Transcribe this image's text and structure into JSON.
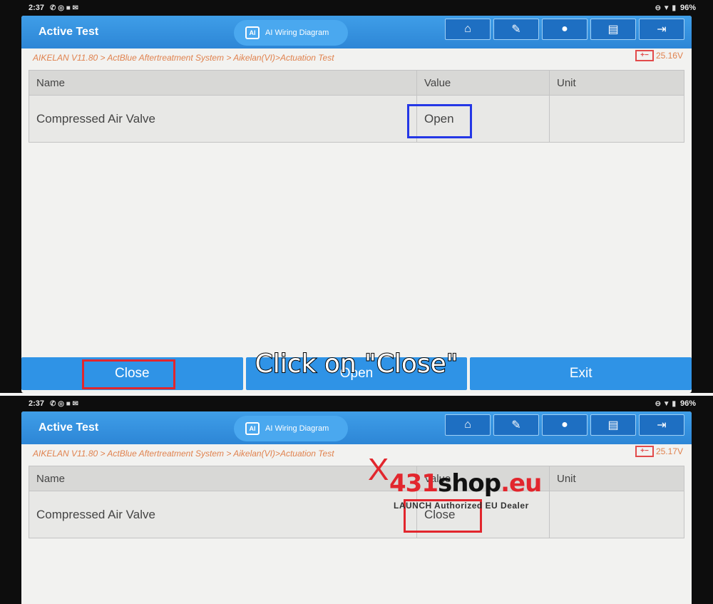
{
  "caption": "Click on \"Close\"",
  "watermark": {
    "brand_x": "X",
    "brand_num": "431",
    "brand_shop": "shop",
    "brand_tld": ".eu",
    "tagline": "LAUNCH Authorized EU Dealer"
  },
  "frames": [
    {
      "status": {
        "time": "2:37",
        "battery": "96%"
      },
      "title": "Active Test",
      "ai_button": "AI Wiring Diagram",
      "ai_icon_text": "AI",
      "breadcrumb": "AIKELAN  V11.80 > ActBlue Aftertreatment System > Aikelan(VI)>Actuation Test",
      "voltage": "25.16V",
      "columns": [
        "Name",
        "Value",
        "Unit"
      ],
      "row": {
        "name": "Compressed Air Valve",
        "value": "Open",
        "unit": ""
      },
      "buttons": [
        "Close",
        "Open",
        "Exit"
      ]
    },
    {
      "status": {
        "time": "2:37",
        "battery": "96%"
      },
      "title": "Active Test",
      "ai_button": "AI Wiring Diagram",
      "ai_icon_text": "AI",
      "breadcrumb": "AIKELAN  V11.80 > ActBlue Aftertreatment System > Aikelan(VI)>Actuation Test",
      "voltage": "25.17V",
      "columns": [
        "Name",
        "Value",
        "Unit"
      ],
      "row": {
        "name": "Compressed Air Valve",
        "value": "Close",
        "unit": ""
      }
    }
  ],
  "toolbar_icons": [
    "home-icon",
    "edit-icon",
    "chat-icon",
    "print-icon",
    "exit-icon"
  ],
  "colors": {
    "accent": "#2f93e6",
    "highlight_blue": "#2437e6",
    "highlight_red": "#e2262d",
    "breadcrumb": "#e0824e"
  }
}
